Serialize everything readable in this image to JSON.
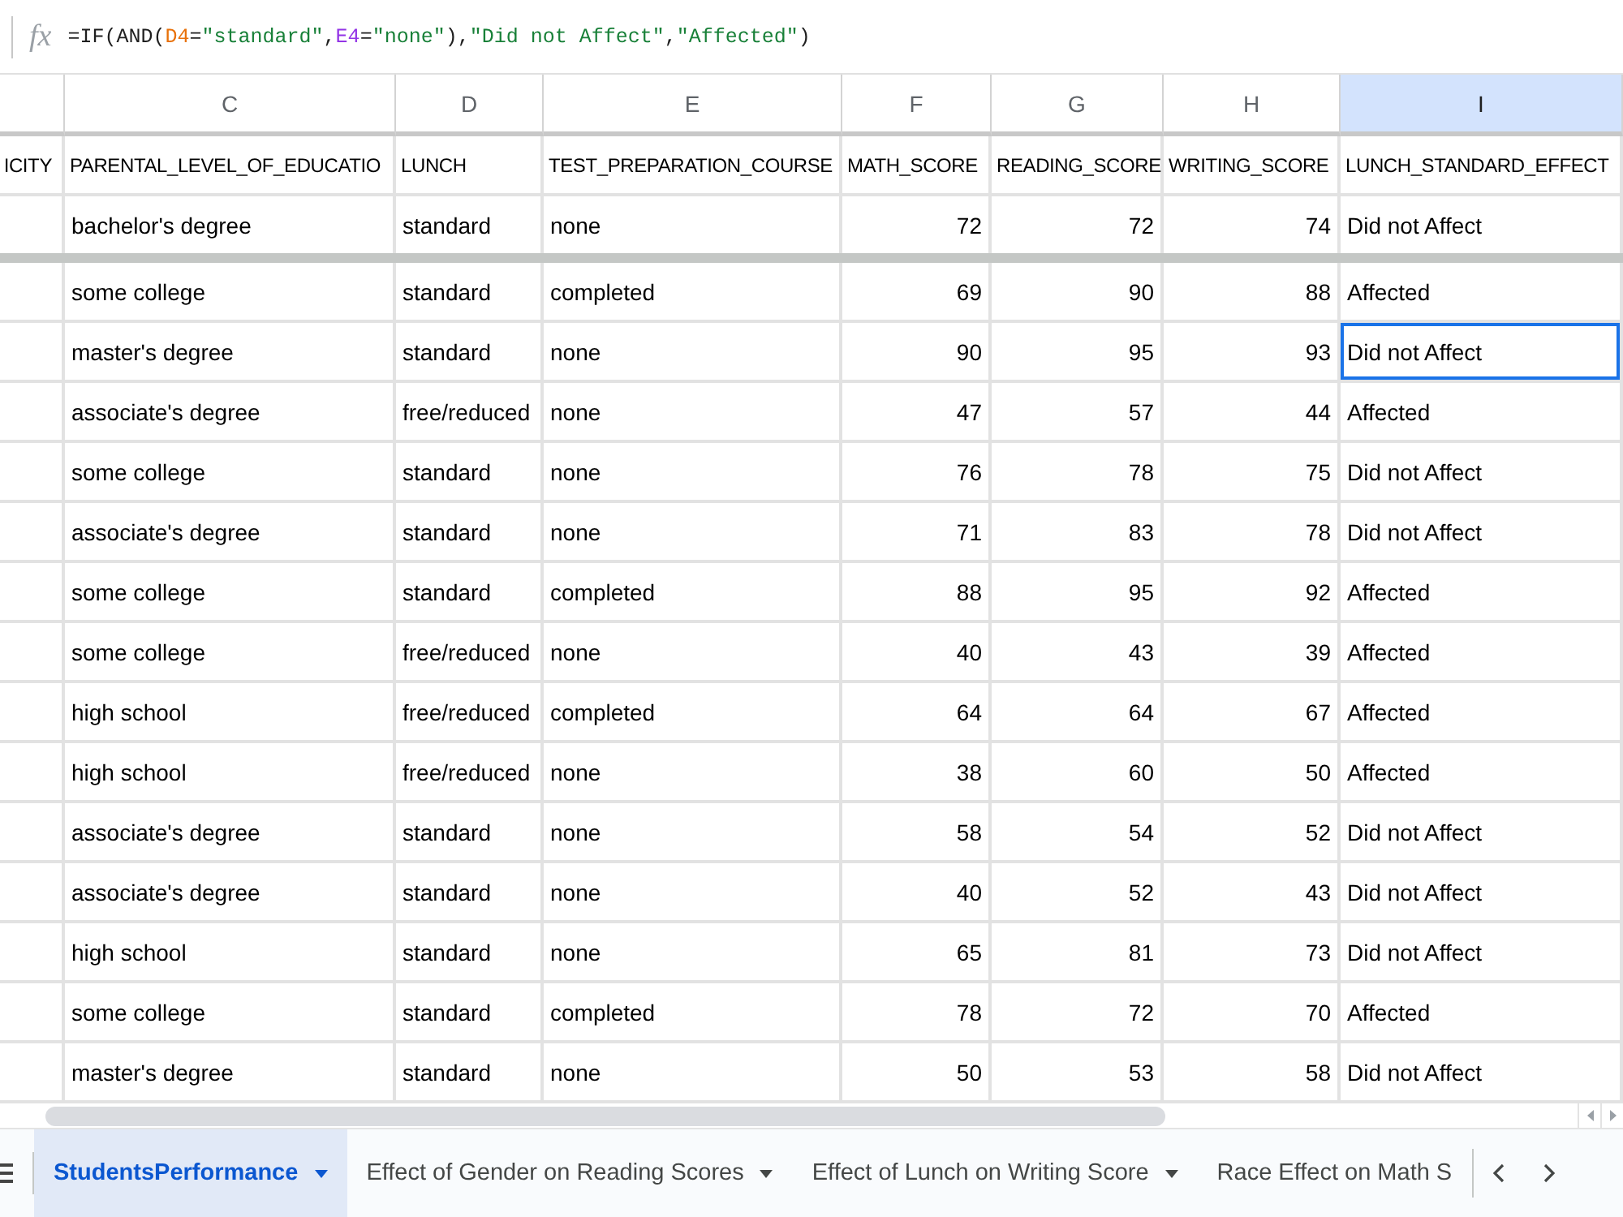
{
  "formula_bar": {
    "icon_label": "fx",
    "formula": [
      {
        "kind": "text",
        "text": "=IF(AND("
      },
      {
        "kind": "ref",
        "text": "D4",
        "color": "#e8710a"
      },
      {
        "kind": "text",
        "text": "="
      },
      {
        "kind": "string",
        "text": "\"standard\""
      },
      {
        "kind": "text",
        "text": ","
      },
      {
        "kind": "ref",
        "text": "E4",
        "color": "#9334e6"
      },
      {
        "kind": "text",
        "text": "="
      },
      {
        "kind": "string",
        "text": "\"none\""
      },
      {
        "kind": "text",
        "text": "),"
      },
      {
        "kind": "string",
        "text": "\"Did not Affect\""
      },
      {
        "kind": "text",
        "text": ","
      },
      {
        "kind": "string",
        "text": "\"Affected\""
      },
      {
        "kind": "text",
        "text": ")"
      }
    ]
  },
  "table": {
    "partial_column": {
      "header": "ICITY"
    },
    "columns": [
      {
        "letter": "C",
        "header": "PARENTAL_LEVEL_OF_EDUCATIO",
        "kind": "text",
        "selected": false
      },
      {
        "letter": "D",
        "header": "LUNCH",
        "kind": "text",
        "selected": false
      },
      {
        "letter": "E",
        "header": "TEST_PREPARATION_COURSE",
        "kind": "text",
        "selected": false
      },
      {
        "letter": "F",
        "header": "MATH_SCORE",
        "kind": "number",
        "selected": false
      },
      {
        "letter": "G",
        "header": "READING_SCORE",
        "kind": "number",
        "selected": false
      },
      {
        "letter": "H",
        "header": "WRITING_SCORE",
        "kind": "number",
        "selected": false
      },
      {
        "letter": "I",
        "header": "LUNCH_STANDARD_EFFECT",
        "kind": "text",
        "selected": true
      }
    ],
    "frozen_rows": [
      {
        "cells": [
          "bachelor's degree",
          "standard",
          "none",
          "72",
          "72",
          "74",
          "Did not Affect"
        ],
        "selected": false
      }
    ],
    "rows": [
      {
        "cells": [
          "some college",
          "standard",
          "completed",
          "69",
          "90",
          "88",
          "Affected"
        ],
        "selected": false
      },
      {
        "cells": [
          "master's degree",
          "standard",
          "none",
          "90",
          "95",
          "93",
          "Did not Affect"
        ],
        "selected": true
      },
      {
        "cells": [
          "associate's degree",
          "free/reduced",
          "none",
          "47",
          "57",
          "44",
          "Affected"
        ],
        "selected": false
      },
      {
        "cells": [
          "some college",
          "standard",
          "none",
          "76",
          "78",
          "75",
          "Did not Affect"
        ],
        "selected": false
      },
      {
        "cells": [
          "associate's degree",
          "standard",
          "none",
          "71",
          "83",
          "78",
          "Did not Affect"
        ],
        "selected": false
      },
      {
        "cells": [
          "some college",
          "standard",
          "completed",
          "88",
          "95",
          "92",
          "Affected"
        ],
        "selected": false
      },
      {
        "cells": [
          "some college",
          "free/reduced",
          "none",
          "40",
          "43",
          "39",
          "Affected"
        ],
        "selected": false
      },
      {
        "cells": [
          "high school",
          "free/reduced",
          "completed",
          "64",
          "64",
          "67",
          "Affected"
        ],
        "selected": false
      },
      {
        "cells": [
          "high school",
          "free/reduced",
          "none",
          "38",
          "60",
          "50",
          "Affected"
        ],
        "selected": false
      },
      {
        "cells": [
          "associate's degree",
          "standard",
          "none",
          "58",
          "54",
          "52",
          "Did not Affect"
        ],
        "selected": false
      },
      {
        "cells": [
          "associate's degree",
          "standard",
          "none",
          "40",
          "52",
          "43",
          "Did not Affect"
        ],
        "selected": false
      },
      {
        "cells": [
          "high school",
          "standard",
          "none",
          "65",
          "81",
          "73",
          "Did not Affect"
        ],
        "selected": false
      },
      {
        "cells": [
          "some college",
          "standard",
          "completed",
          "78",
          "72",
          "70",
          "Affected"
        ],
        "selected": false
      },
      {
        "cells": [
          "master's degree",
          "standard",
          "none",
          "50",
          "53",
          "58",
          "Did not Affect"
        ],
        "selected": false
      }
    ]
  },
  "sheet_tabs": [
    {
      "label": "StudentsPerformance",
      "selected": true,
      "dropdown": true
    },
    {
      "label": "Effect of Gender on Reading Scores",
      "selected": false,
      "dropdown": true
    },
    {
      "label": "Effect of Lunch on Writing Score",
      "selected": false,
      "dropdown": true
    },
    {
      "label": "Race Effect on Math S",
      "selected": false,
      "dropdown": false
    }
  ]
}
